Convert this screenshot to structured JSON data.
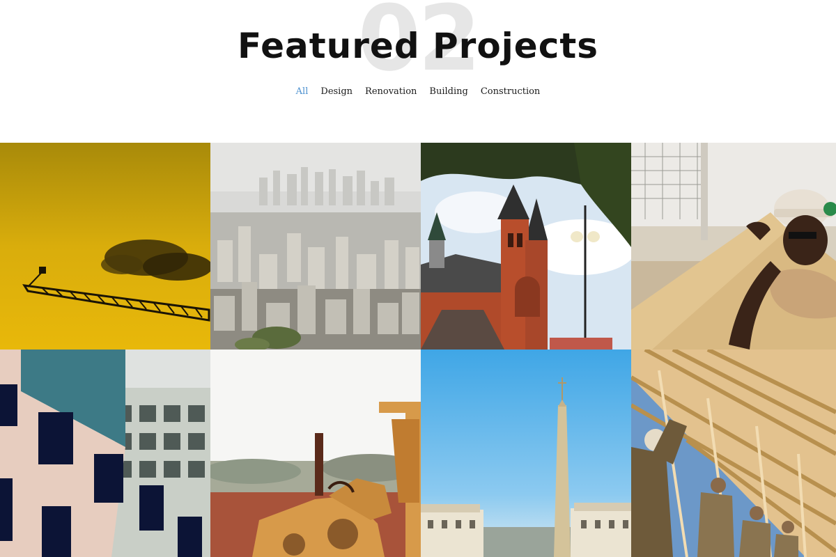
{
  "section": {
    "number": "02",
    "title": "Featured Projects"
  },
  "filters": [
    "All",
    "Design",
    "Renovation",
    "Building",
    "Construction"
  ],
  "active_filter": "All",
  "projects": [
    {
      "subject": "crane"
    },
    {
      "subject": "city-skyline"
    },
    {
      "subject": "church"
    },
    {
      "subject": "worker-plywood"
    },
    {
      "subject": "office-building"
    },
    {
      "subject": "bulldozer"
    },
    {
      "subject": "obelisk"
    },
    {
      "subject": "roof-framing"
    }
  ]
}
